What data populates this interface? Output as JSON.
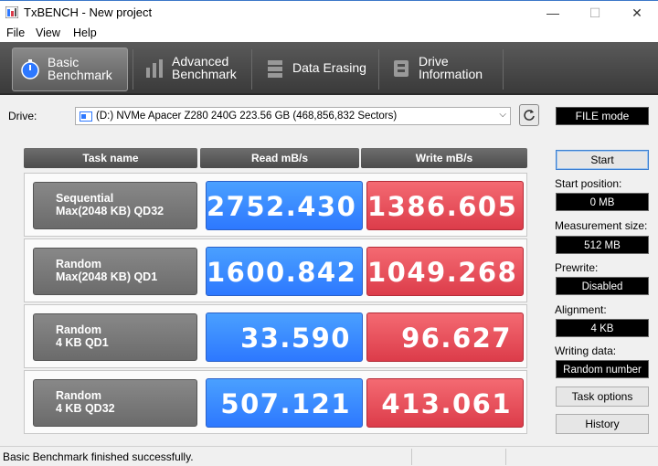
{
  "window": {
    "title": "TxBENCH - New project",
    "minimize": "—",
    "maximize": "☐",
    "close": "✕"
  },
  "menu": [
    "File",
    "View",
    "Help"
  ],
  "toolbar": [
    {
      "line1": "Basic",
      "line2": "Benchmark",
      "icon": "stopwatch-icon",
      "active": true
    },
    {
      "line1": "Advanced",
      "line2": "Benchmark",
      "icon": "bar-chart-icon",
      "active": false
    },
    {
      "line1": "Data Erasing",
      "line2": "",
      "icon": "eraser-icon",
      "active": false
    },
    {
      "line1": "Drive",
      "line2": "Information",
      "icon": "drive-info-icon",
      "active": false
    }
  ],
  "drive": {
    "label": "Drive:",
    "value": "(D:) NVMe Apacer Z280 240G  223.56 GB (468,856,832 Sectors)",
    "mode": "FILE mode"
  },
  "table": {
    "headers": [
      "Task name",
      "Read mB/s",
      "Write mB/s"
    ],
    "rows": [
      {
        "task1": "Sequential",
        "task2": "Max(2048 KB) QD32",
        "read": "2752.430",
        "write": "1386.605"
      },
      {
        "task1": "Random",
        "task2": "Max(2048 KB) QD1",
        "read": "1600.842",
        "write": "1049.268"
      },
      {
        "task1": "Random",
        "task2": "4 KB QD1",
        "read": "33.590",
        "write": "96.627"
      },
      {
        "task1": "Random",
        "task2": "4 KB QD32",
        "read": "507.121",
        "write": "413.061"
      }
    ]
  },
  "side": {
    "start": "Start",
    "start_position_label": "Start position:",
    "start_position": "0 MB",
    "measurement_size_label": "Measurement size:",
    "measurement_size": "512 MB",
    "prewrite_label": "Prewrite:",
    "prewrite": "Disabled",
    "alignment_label": "Alignment:",
    "alignment": "4 KB",
    "writing_data_label": "Writing data:",
    "writing_data": "Random number",
    "task_options": "Task options",
    "history": "History"
  },
  "status": {
    "message": "Basic Benchmark finished successfully."
  },
  "colors": {
    "read": "#2d78ff",
    "write": "#dc3c4a",
    "toolbar": "#4a4a4a",
    "value_box": "#000000"
  }
}
